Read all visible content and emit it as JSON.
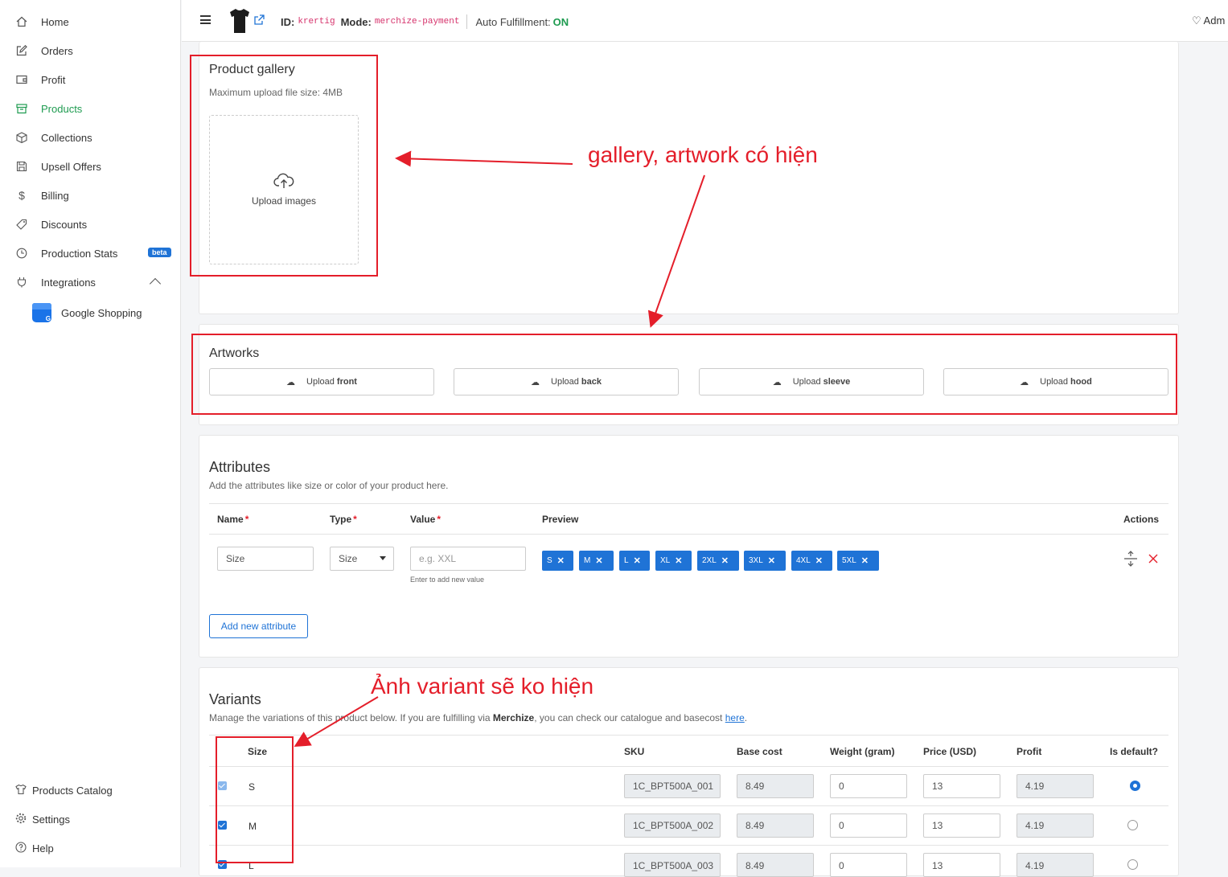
{
  "sidebar": {
    "items": [
      {
        "label": "Home",
        "icon": "home-icon"
      },
      {
        "label": "Orders",
        "icon": "edit-icon"
      },
      {
        "label": "Profit",
        "icon": "wallet-icon"
      },
      {
        "label": "Products",
        "icon": "box-icon"
      },
      {
        "label": "Collections",
        "icon": "cube-icon"
      },
      {
        "label": "Upsell Offers",
        "icon": "save-icon"
      },
      {
        "label": "Billing",
        "icon": "dollar-icon"
      },
      {
        "label": "Discounts",
        "icon": "tag-icon"
      },
      {
        "label": "Production Stats",
        "icon": "clock-icon",
        "badge": "beta"
      },
      {
        "label": "Integrations",
        "icon": "plug-icon"
      }
    ],
    "sub_item": {
      "label": "Google Shopping",
      "icon_letter": "G"
    },
    "bottom": [
      {
        "label": "Products Catalog",
        "icon": "shirt-icon"
      },
      {
        "label": "Settings",
        "icon": "gear-icon"
      },
      {
        "label": "Help",
        "icon": "help-icon"
      }
    ],
    "active_color": "#1e9b50"
  },
  "header": {
    "id_label": "ID:",
    "id_value": "krertig",
    "mode_label": "Mode:",
    "mode_value": "merchize-payment",
    "auto_label": "Auto Fulfillment:",
    "auto_value": "ON",
    "admin_text": "♡ Adm"
  },
  "gallery": {
    "title": "Product gallery",
    "subtitle": "Maximum upload file size: 4MB",
    "upload_label": "Upload images"
  },
  "artworks": {
    "title": "Artworks",
    "upload_prefix": "Upload",
    "buttons": [
      "front",
      "back",
      "sleeve",
      "hood"
    ]
  },
  "attributes": {
    "title": "Attributes",
    "subtitle": "Add the attributes like size or color of your product here.",
    "headers": {
      "name": "Name",
      "type": "Type",
      "value": "Value",
      "preview": "Preview",
      "actions": "Actions"
    },
    "row": {
      "name": "Size",
      "type": "Size",
      "value_placeholder": "e.g. XXL",
      "hint": "Enter to add new value",
      "chips": [
        "S",
        "M",
        "L",
        "XL",
        "2XL",
        "3XL",
        "4XL",
        "5XL"
      ]
    },
    "add_button": "Add new attribute"
  },
  "variants": {
    "title": "Variants",
    "subtitle_pre": "Manage the variations of this product below. If you are fulfilling via ",
    "subtitle_brand": "Merchize",
    "subtitle_mid": ", you can check our catalogue and basecost ",
    "subtitle_link": "here",
    "subtitle_end": ".",
    "headers": {
      "size": "Size",
      "sku": "SKU",
      "base": "Base cost",
      "weight": "Weight (gram)",
      "price": "Price (USD)",
      "profit": "Profit",
      "default": "Is default?"
    },
    "rows": [
      {
        "size": "S",
        "sku": "1C_BPT500A_001",
        "base": "8.49",
        "weight": "0",
        "price": "13",
        "profit": "4.19",
        "default": true
      },
      {
        "size": "M",
        "sku": "1C_BPT500A_002",
        "base": "8.49",
        "weight": "0",
        "price": "13",
        "profit": "4.19",
        "default": false
      },
      {
        "size": "L",
        "sku": "1C_BPT500A_003",
        "base": "8.49",
        "weight": "0",
        "price": "13",
        "profit": "4.19",
        "default": false
      }
    ]
  },
  "annotations": {
    "note1": "gallery, artwork có hiện",
    "note2": "Ảnh variant sẽ ko hiện",
    "color": "#e41e2a"
  }
}
